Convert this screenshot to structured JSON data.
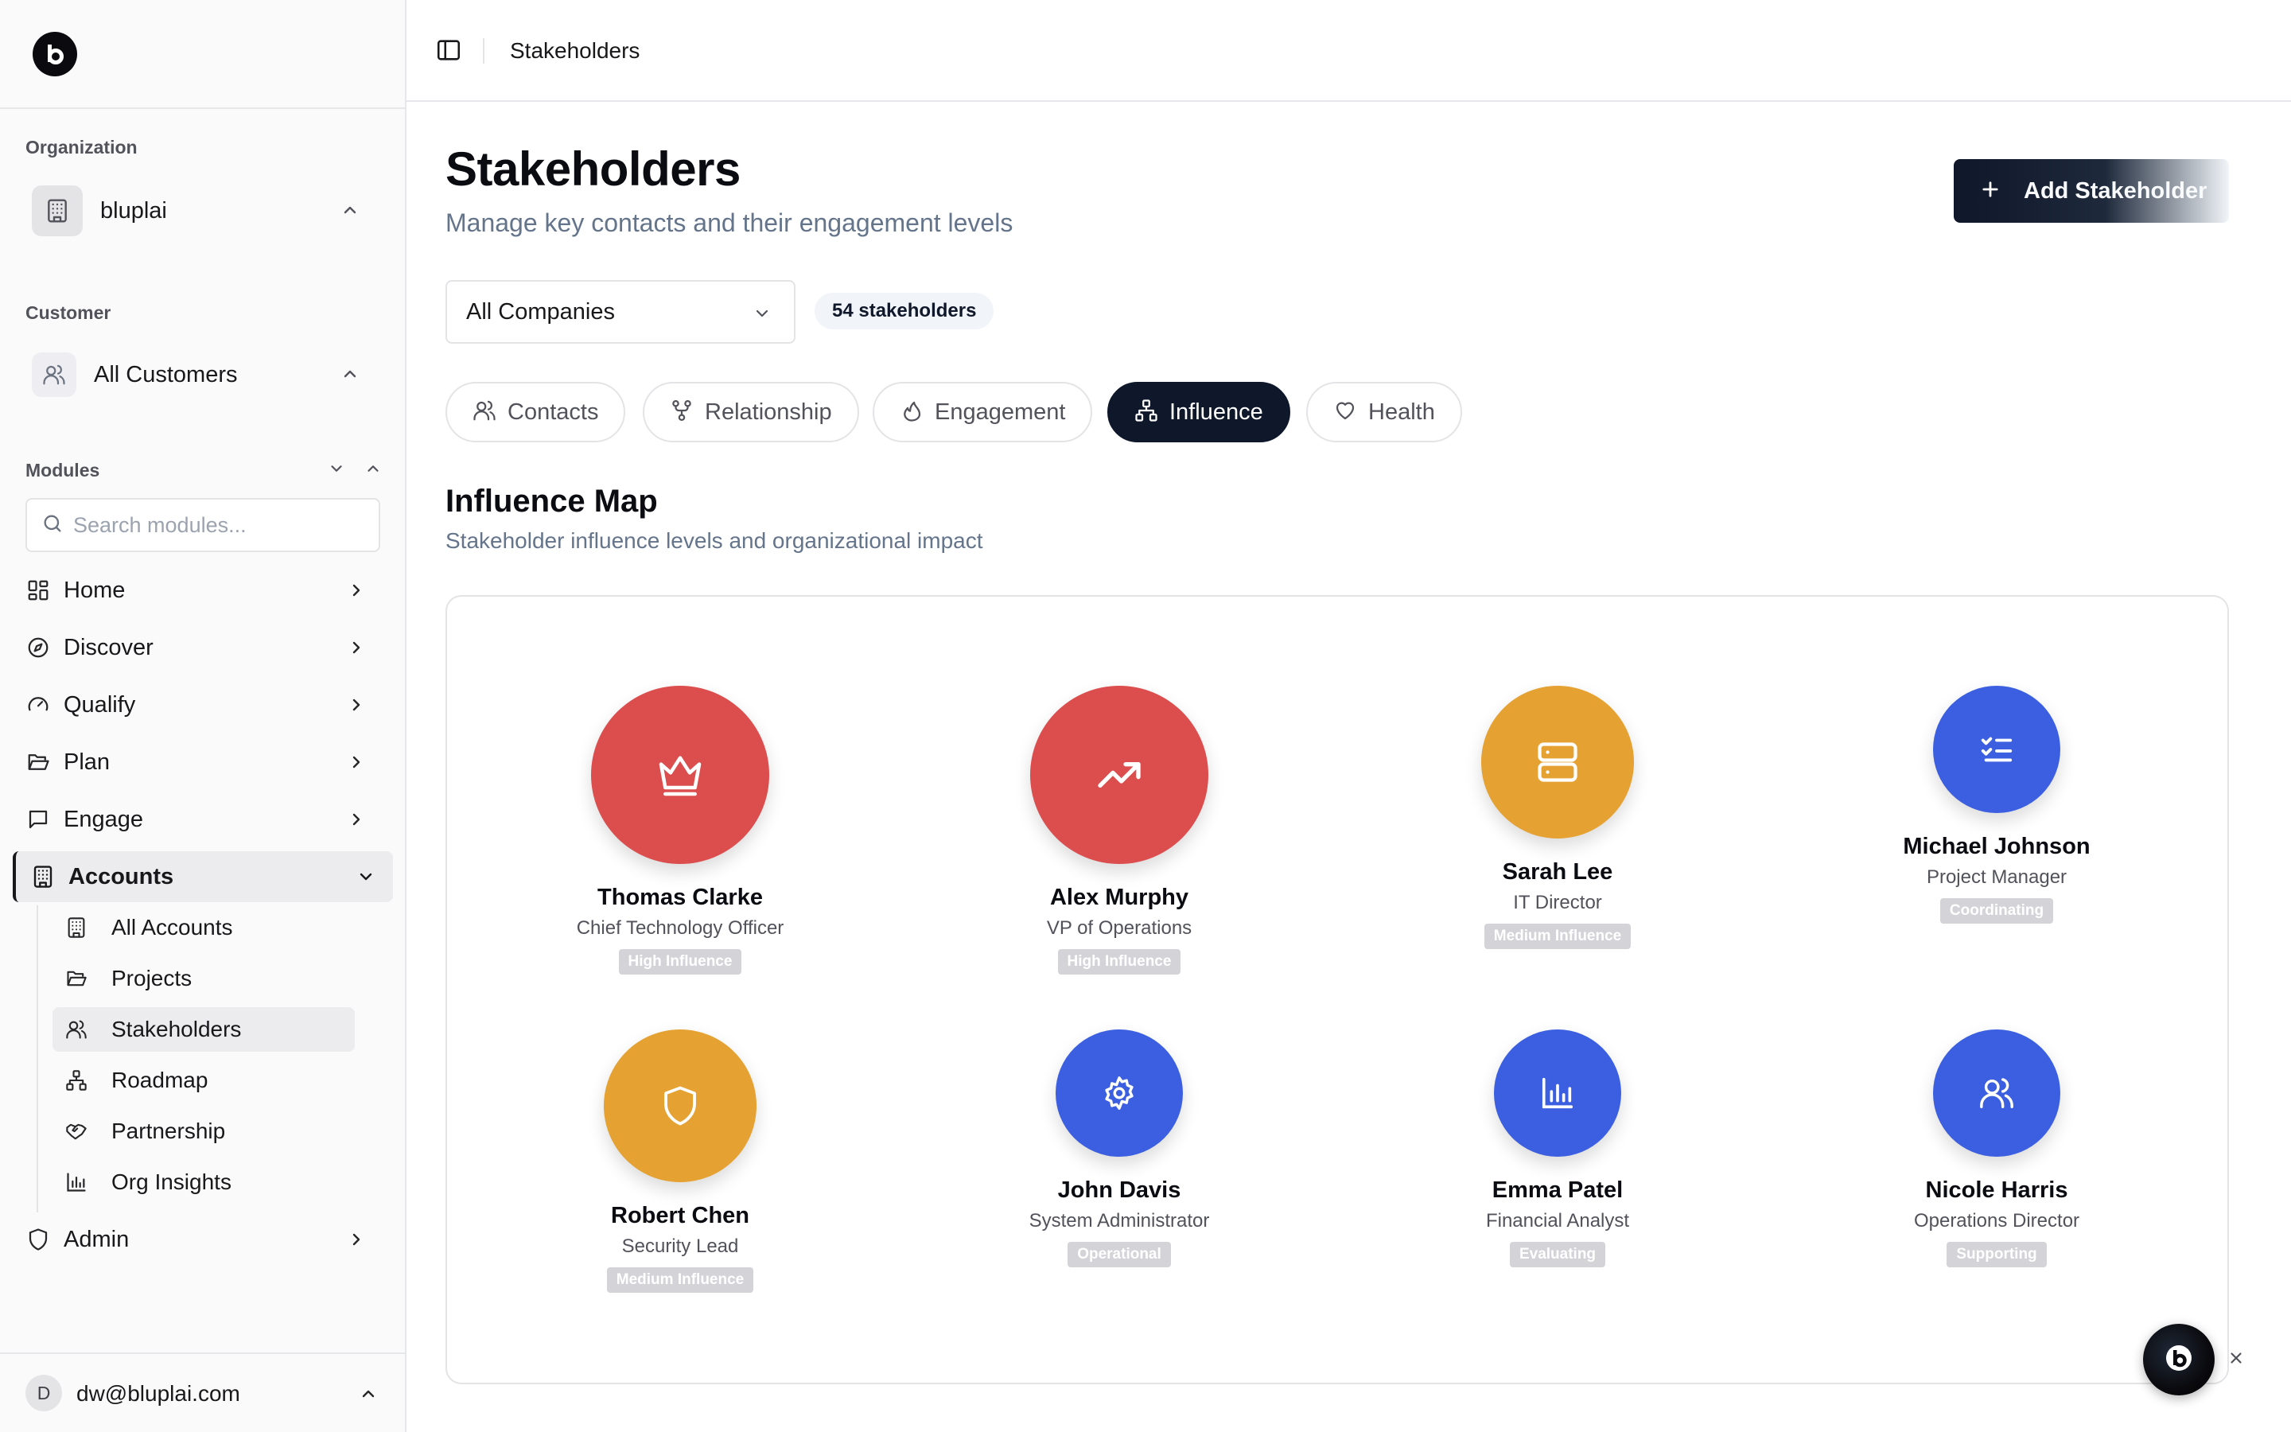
{
  "app": {
    "logo_icon": "bluplai-logo-icon"
  },
  "sidebar": {
    "organization_label": "Organization",
    "organization_name": "bluplai",
    "customer_label": "Customer",
    "customer_name": "All Customers",
    "modules_label": "Modules",
    "search_placeholder": "Search modules...",
    "nav": [
      {
        "label": "Home",
        "icon": "grid-icon"
      },
      {
        "label": "Discover",
        "icon": "compass-icon"
      },
      {
        "label": "Qualify",
        "icon": "gauge-icon"
      },
      {
        "label": "Plan",
        "icon": "folder-open-icon"
      },
      {
        "label": "Engage",
        "icon": "message-square-icon"
      }
    ],
    "accounts": {
      "label": "Accounts",
      "icon": "building-icon",
      "children": [
        {
          "label": "All Accounts",
          "icon": "building-icon"
        },
        {
          "label": "Projects",
          "icon": "folder-open-icon"
        },
        {
          "label": "Stakeholders",
          "icon": "users-icon",
          "active": true
        },
        {
          "label": "Roadmap",
          "icon": "network-icon"
        },
        {
          "label": "Partnership",
          "icon": "handshake-icon"
        },
        {
          "label": "Org Insights",
          "icon": "bar-chart-icon"
        }
      ]
    },
    "admin": {
      "label": "Admin",
      "icon": "shield-icon"
    },
    "user": {
      "initial": "D",
      "email": "dw@bluplai.com"
    }
  },
  "topbar": {
    "title": "Stakeholders"
  },
  "header": {
    "title": "Stakeholders",
    "subtitle": "Manage key contacts and their engagement levels",
    "add_button": "Add Stakeholder"
  },
  "filters": {
    "company_select": "All Companies",
    "count_badge": "54 stakeholders"
  },
  "tabs": [
    {
      "label": "Contacts",
      "icon": "users-icon"
    },
    {
      "label": "Relationship",
      "icon": "git-fork-icon"
    },
    {
      "label": "Engagement",
      "icon": "flame-icon"
    },
    {
      "label": "Influence",
      "icon": "network-icon",
      "active": true
    },
    {
      "label": "Health",
      "icon": "heart-icon"
    }
  ],
  "influence": {
    "title": "Influence Map",
    "subtitle": "Stakeholder influence levels and organizational impact",
    "colors": {
      "high": "#dc4d4d",
      "medium": "#e5a233",
      "low": "#3b5fe0"
    },
    "stakeholders": [
      {
        "name": "Thomas Clarke",
        "role": "Chief Technology Officer",
        "badge": "High Influence",
        "icon": "crown-icon",
        "level": "high"
      },
      {
        "name": "Alex Murphy",
        "role": "VP of Operations",
        "badge": "High Influence",
        "icon": "trending-up-icon",
        "level": "high"
      },
      {
        "name": "Sarah Lee",
        "role": "IT Director",
        "badge": "Medium Influence",
        "icon": "server-icon",
        "level": "medium"
      },
      {
        "name": "Michael Johnson",
        "role": "Project Manager",
        "badge": "Coordinating",
        "icon": "list-checks-icon",
        "level": "low"
      },
      {
        "name": "Robert Chen",
        "role": "Security Lead",
        "badge": "Medium Influence",
        "icon": "shield-icon",
        "level": "medium"
      },
      {
        "name": "John Davis",
        "role": "System Administrator",
        "badge": "Operational",
        "icon": "settings-icon",
        "level": "low"
      },
      {
        "name": "Emma Patel",
        "role": "Financial Analyst",
        "badge": "Evaluating",
        "icon": "bar-chart-icon",
        "level": "low"
      },
      {
        "name": "Nicole Harris",
        "role": "Operations Director",
        "badge": "Supporting",
        "icon": "users-icon",
        "level": "low"
      }
    ]
  },
  "assistant": {
    "icon": "bluplai-logo-icon",
    "close_icon": "close-icon"
  }
}
